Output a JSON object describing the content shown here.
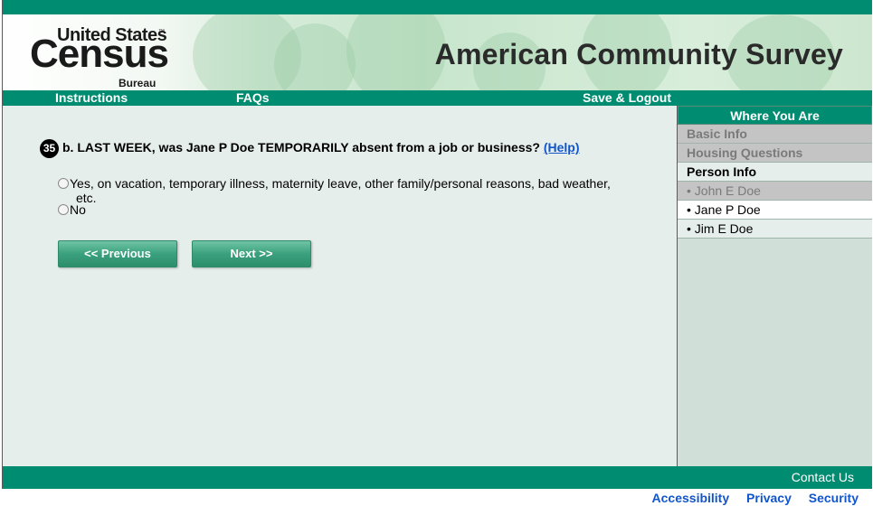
{
  "logo": {
    "line1": "United States",
    "line2": "Census",
    "tm": "™",
    "line3": "Bureau"
  },
  "header": {
    "title": "American Community Survey"
  },
  "nav": {
    "instructions": "Instructions",
    "faqs": "FAQs",
    "save_logout": "Save & Logout"
  },
  "question": {
    "number": "35",
    "text": "b. LAST WEEK, was Jane P Doe TEMPORARILY absent from a job or business?",
    "help": "(Help)",
    "options": [
      {
        "label_line1": "Yes, on vacation, temporary illness, maternity leave, other family/personal reasons, bad weather,",
        "label_line2": "etc.",
        "selected": false
      },
      {
        "label_line1": "No",
        "selected": false
      }
    ]
  },
  "buttons": {
    "previous": "<<   Previous",
    "next": "Next   >>"
  },
  "sidebar": {
    "title": "Where You Are",
    "items": [
      {
        "label": "Basic Info",
        "state": "done"
      },
      {
        "label": "Housing Questions",
        "state": "done"
      },
      {
        "label": "Person Info",
        "state": "section"
      },
      {
        "label": "• John E Doe",
        "state": "person-done"
      },
      {
        "label": "• Jane P Doe",
        "state": "current"
      },
      {
        "label": "• Jim E Doe",
        "state": "pending"
      }
    ]
  },
  "footer": {
    "contact": "Contact Us",
    "links": [
      "Accessibility",
      "Privacy",
      "Security"
    ]
  },
  "colors": {
    "brand_green": "#008c70",
    "link_blue": "#1155cc",
    "content_bg": "#e6eeeb",
    "sidebar_bg": "#d0e0d8"
  }
}
